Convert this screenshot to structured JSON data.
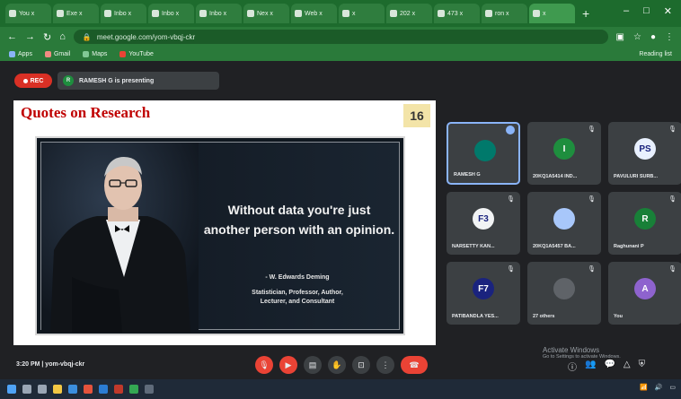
{
  "browser": {
    "tabs": [
      {
        "label": "You x"
      },
      {
        "label": "Exe x"
      },
      {
        "label": "Inbo x"
      },
      {
        "label": "Inbo x"
      },
      {
        "label": "Inbo x"
      },
      {
        "label": "Nex x"
      },
      {
        "label": "Web x"
      },
      {
        "label": "x"
      },
      {
        "label": "202 x"
      },
      {
        "label": "473 x"
      },
      {
        "label": "ron x"
      },
      {
        "label": "x",
        "active": true
      }
    ],
    "new_tab": "+",
    "url": "meet.google.com/yom-vbqj-ckr",
    "bookmarks": [
      {
        "label": "Apps",
        "color": "#8ab4f8"
      },
      {
        "label": "Gmail",
        "color": "#f28b82"
      },
      {
        "label": "Maps",
        "color": "#81c995"
      },
      {
        "label": "YouTube",
        "color": "#ea4335"
      }
    ],
    "reading_list": "Reading list"
  },
  "meet": {
    "rec_label": "REC",
    "presenter_initial": "R",
    "presenting_text": "RAMESH G is presenting",
    "slide": {
      "title": "Quotes on Research",
      "number": "16",
      "quote_line1": "Without data you're just",
      "quote_line2": "another person with an opinion.",
      "author": "- W. Edwards Deming",
      "roles_line1": "Statistician, Professor, Author,",
      "roles_line2": "Lecturer, and Consultant"
    },
    "tiles": [
      {
        "name": "RAMESH G",
        "initial": "",
        "color": "#00796b",
        "speaking": true
      },
      {
        "name": "20KQ1A5414 IND...",
        "initial": "I",
        "color": "#1e8e3e"
      },
      {
        "name": "PAVULURI SURB...",
        "initial": "PS",
        "color": "#e8f0fe"
      },
      {
        "name": "NARSETTY KAN...",
        "initial": "F3",
        "color": "#f1f3f4"
      },
      {
        "name": "20KQ1A5457 BA...",
        "initial": "",
        "color": "#a8c7fa"
      },
      {
        "name": "Raghunani P",
        "initial": "R",
        "color": "#188038"
      },
      {
        "name": "PATIBANDLA YES...",
        "initial": "F7",
        "color": "#1a237e"
      },
      {
        "name": "27 others",
        "initial": "",
        "color": "#5f6368"
      },
      {
        "name": "You",
        "initial": "A",
        "color": "#8e63ce"
      }
    ],
    "meeting_info": "3:20 PM | yom-vbqj-ckr",
    "activate_windows": "Activate Windows",
    "activate_sub": "Go to Settings to activate Windows."
  }
}
